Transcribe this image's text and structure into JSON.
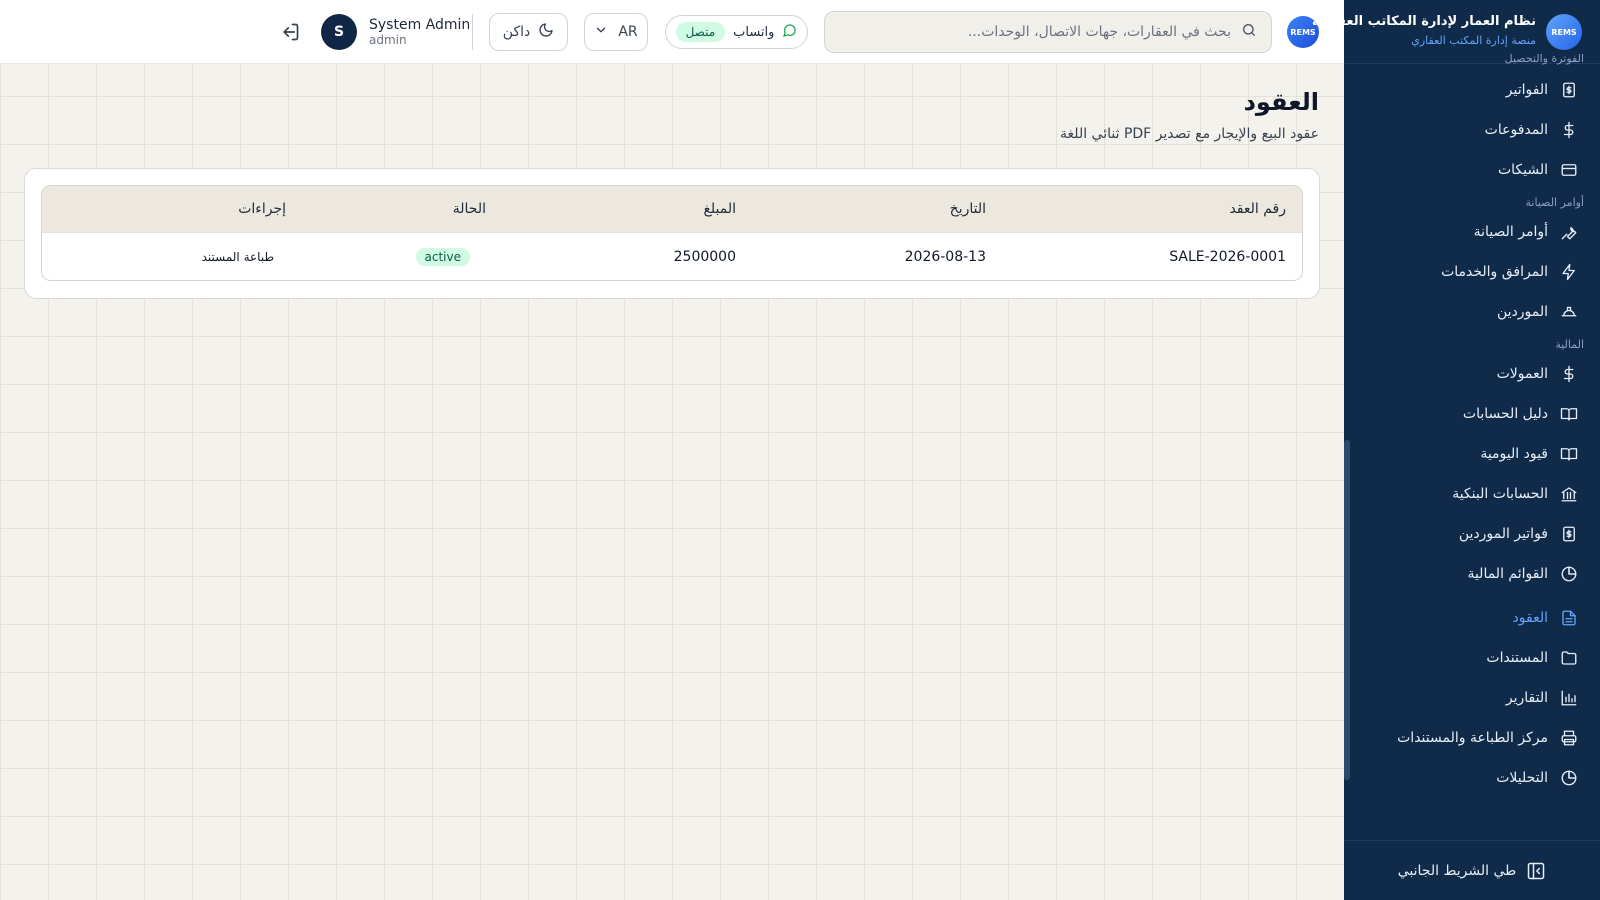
{
  "header": {
    "search_placeholder": "بحث في العقارات، جهات الاتصال، الوحدات...",
    "brand_mini": "REMS",
    "whatsapp_label": "واتساب",
    "whatsapp_status": "متصل",
    "language": "AR",
    "theme_label": "داكن",
    "user_name": "System Admin",
    "user_role": "admin",
    "avatar_initial": "S"
  },
  "page": {
    "title": "العقود",
    "subtitle": "عقود البيع والإيجار مع تصدير PDF ثنائي اللغة"
  },
  "table": {
    "headers": [
      "رقم العقد",
      "التاريخ",
      "المبلغ",
      "الحالة",
      "إجراءات"
    ],
    "rows": [
      {
        "contract_no": "SALE-2026-0001",
        "date": "2026-08-13",
        "amount": "2500000",
        "status": "active",
        "action": "طباعة المستند"
      }
    ]
  },
  "sidebar": {
    "brand_logo": "REMS",
    "brand_title": "نظام العمار لإدارة المكاتب العقارية",
    "brand_subtitle": "منصة إدارة المكتب العقاري",
    "cut_section_label": "الفوترة والتحصيل",
    "items_billing": [
      {
        "label": "الفواتير",
        "icon": "invoice-icon"
      },
      {
        "label": "المدفوعات",
        "icon": "dollar-icon"
      },
      {
        "label": "الشيكات",
        "icon": "card-icon"
      }
    ],
    "section_maintenance": "أوامر الصيانة",
    "items_maintenance": [
      {
        "label": "أوامر الصيانة",
        "icon": "wrench-icon"
      },
      {
        "label": "المرافق والخدمات",
        "icon": "bolt-icon"
      },
      {
        "label": "الموردين",
        "icon": "hardhat-icon"
      }
    ],
    "section_finance": "المالية",
    "items_finance": [
      {
        "label": "العمولات",
        "icon": "dollar-icon"
      },
      {
        "label": "دليل الحسابات",
        "icon": "book-icon"
      },
      {
        "label": "قيود اليومية",
        "icon": "book-icon"
      },
      {
        "label": "الحسابات البنكية",
        "icon": "bank-icon"
      },
      {
        "label": "فواتير الموردين",
        "icon": "invoice-icon"
      },
      {
        "label": "القوائم المالية",
        "icon": "pie-icon"
      },
      {
        "label": "العقود",
        "icon": "document-icon",
        "active": true
      },
      {
        "label": "المستندات",
        "icon": "folder-icon"
      },
      {
        "label": "التقارير",
        "icon": "barchart-icon"
      },
      {
        "label": "مركز الطباعة والمستندات",
        "icon": "printer-icon"
      },
      {
        "label": "التحليلات",
        "icon": "pie-icon"
      }
    ],
    "collapse_label": "طي الشريط الجانبي"
  },
  "colors": {
    "sidebar_bg": "#102a4a",
    "accent": "#60a5fa",
    "success_bg": "#d1fae5",
    "success_text": "#065f46"
  }
}
